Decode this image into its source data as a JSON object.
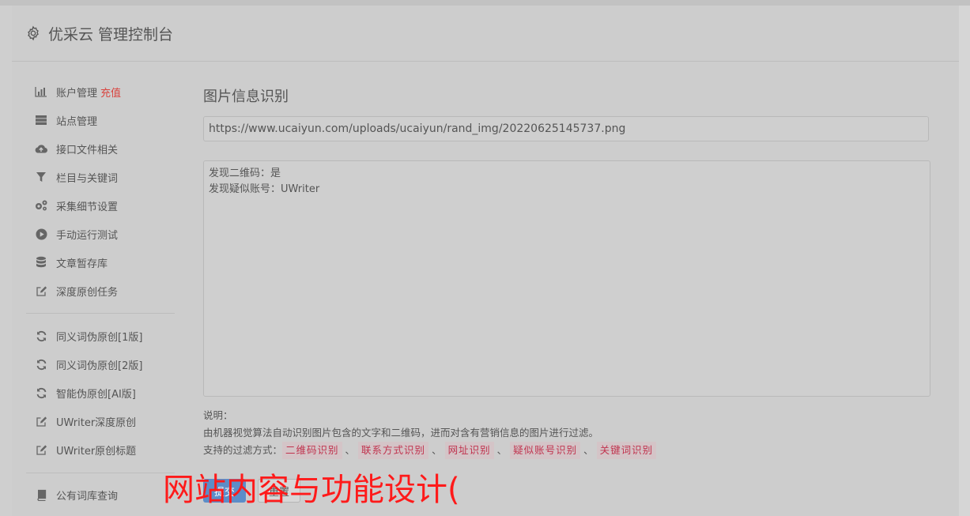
{
  "header": {
    "title": "优采云 管理控制台",
    "icon": "gear-icon"
  },
  "sidebar": {
    "items": [
      {
        "label": "账户管理",
        "extra": "充值",
        "icon": "bar-chart-icon"
      },
      {
        "label": "站点管理",
        "icon": "server-icon"
      },
      {
        "label": "接口文件相关",
        "icon": "cloud-upload-icon"
      },
      {
        "label": "栏目与关键词",
        "icon": "filter-icon"
      },
      {
        "label": "采集细节设置",
        "icon": "gears-icon"
      },
      {
        "label": "手动运行测试",
        "icon": "play-circle-icon"
      },
      {
        "label": "文章暂存库",
        "icon": "database-icon"
      },
      {
        "label": "深度原创任务",
        "icon": "edit-icon"
      },
      {
        "label": "同义词伪原创[1版]",
        "icon": "refresh-icon"
      },
      {
        "label": "同义词伪原创[2版]",
        "icon": "refresh-icon"
      },
      {
        "label": "智能伪原创[AI版]",
        "icon": "refresh-icon"
      },
      {
        "label": "UWriter深度原创",
        "icon": "edit-icon"
      },
      {
        "label": "UWriter原创标题",
        "icon": "edit-icon"
      },
      {
        "label": "公有词库查询",
        "icon": "book-icon"
      }
    ]
  },
  "main": {
    "title": "图片信息识别",
    "url_value": "https://www.ucaiyun.com/uploads/ucaiyun/rand_img/20220625145737.png",
    "result_lines": "发现二维码：是\n发现疑似账号：UWriter",
    "notes_heading": "说明：",
    "notes_desc": "由机器视觉算法自动识别图片包含的文字和二维码，进而对含有营销信息的图片进行过滤。",
    "filter_prefix": "支持的过滤方式：",
    "filters": [
      "二维码识别",
      "联系方式识别",
      "网址识别",
      "疑似账号识别",
      "关键词识别"
    ],
    "separator": "、",
    "submit_label": "提交",
    "reset_label": "重置"
  },
  "overlay": {
    "watermark_text": "网站内容与功能设计("
  },
  "colors": {
    "accent": "#d9443f",
    "tag_text": "#c0334e",
    "button": "#5d8dc8",
    "watermark": "#ff1a1a"
  }
}
